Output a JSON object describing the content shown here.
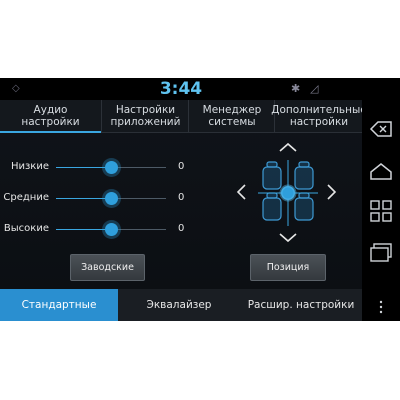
{
  "status": {
    "clock": "3:44"
  },
  "tabs": [
    {
      "label": "Аудио\nнастройки",
      "active": true
    },
    {
      "label": "Настройки\nприложений",
      "active": false
    },
    {
      "label": "Менеджер\nсистемы",
      "active": false
    },
    {
      "label": "Дополнительные\nнастройки",
      "active": false
    }
  ],
  "sliders": [
    {
      "label": "Низкие",
      "value": "0",
      "level": 0.5
    },
    {
      "label": "Средние",
      "value": "0",
      "level": 0.5
    },
    {
      "label": "Высокие",
      "value": "0",
      "level": 0.5
    }
  ],
  "buttons": {
    "factory": "Заводские",
    "position": "Позиция"
  },
  "bottom_tabs": [
    {
      "label": "Стандартные",
      "active": true
    },
    {
      "label": "Эквалайзер",
      "active": false
    },
    {
      "label": "Расшир. настройки",
      "active": false
    }
  ],
  "colors": {
    "accent": "#2f9fdc",
    "clock": "#5fc3f0",
    "active_tab": "#2a8fd0"
  }
}
